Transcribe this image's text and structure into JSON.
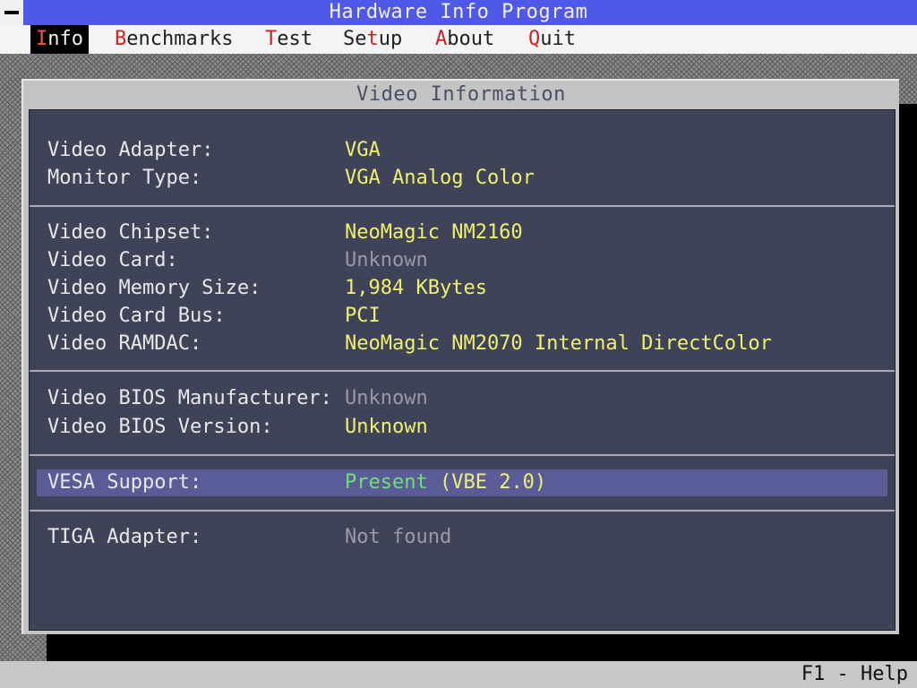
{
  "app": {
    "title": "Hardware Info Program"
  },
  "menu": [
    {
      "hot": "I",
      "rest": "nfo",
      "active": true
    },
    {
      "hot": "B",
      "rest": "enchmarks",
      "active": false
    },
    {
      "hot": "T",
      "rest": "est",
      "active": false
    },
    {
      "pre": "Se",
      "hot": "t",
      "rest": "up",
      "active": false
    },
    {
      "hot": "A",
      "rest": "bout",
      "active": false
    },
    {
      "hot": "Q",
      "rest": "uit",
      "active": false
    }
  ],
  "window": {
    "title": "Video Information"
  },
  "info": {
    "video_adapter": {
      "label": "Video Adapter:",
      "value": "VGA"
    },
    "monitor_type": {
      "label": "Monitor Type:",
      "value": "VGA Analog Color"
    },
    "video_chipset": {
      "label": "Video Chipset:",
      "value": "NeoMagic NM2160"
    },
    "video_card": {
      "label": "Video Card:",
      "value": "Unknown"
    },
    "video_memory": {
      "label": "Video Memory Size:",
      "value": "1,984 KBytes"
    },
    "video_bus": {
      "label": "Video Card Bus:",
      "value": "PCI"
    },
    "video_ramdac": {
      "label": "Video RAMDAC:",
      "value": "NeoMagic NM2070 Internal DirectColor"
    },
    "bios_manufacturer": {
      "label": "Video BIOS Manufacturer:",
      "value": "Unknown"
    },
    "bios_version": {
      "label": "Video BIOS Version:",
      "value": "Unknown"
    },
    "vesa": {
      "label": "VESA Support:",
      "value": "Present",
      "detail": "(VBE 2.0)"
    },
    "tiga": {
      "label": "TIGA Adapter:",
      "value": "Not found"
    }
  },
  "status": {
    "help": "F1 - Help"
  },
  "colors": {
    "title_bar": "#5058e8",
    "panel": "#3f4358",
    "value_yellow": "#f0f070",
    "value_gray": "#9a9aa6",
    "value_green": "#70e070",
    "highlight": "#5a5c98",
    "hotkey": "#d02020"
  },
  "icons": {
    "system_menu": "system-menu-icon"
  }
}
